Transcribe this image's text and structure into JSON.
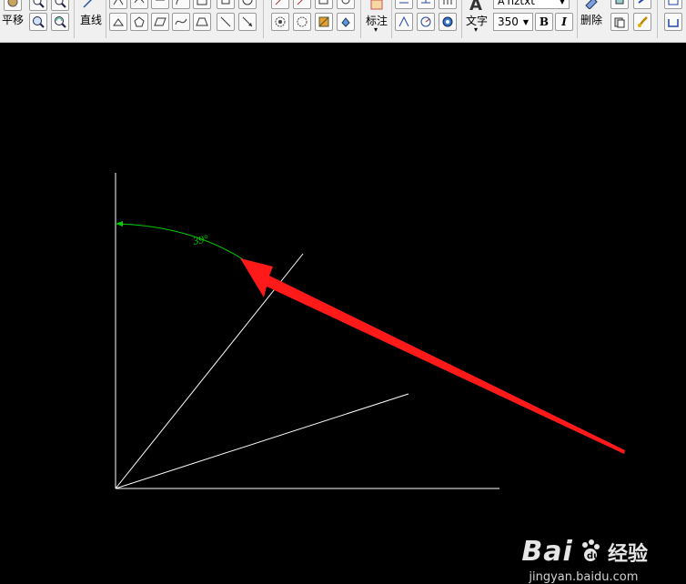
{
  "toolbar": {
    "pan_label": "平移",
    "line_label": "直线",
    "dimension_label": "标注",
    "text_label": "文字",
    "delete_label": "删除",
    "font_letter": "A",
    "font_name": "hztxt",
    "font_size": "350",
    "bold_label": "B",
    "italic_label": "I"
  },
  "drawing": {
    "angle_dimension": "39°",
    "colors": {
      "background": "#000000",
      "lines": "#ffffff",
      "dimension": "#00cc00",
      "arrow": "#ff1a1a"
    }
  },
  "watermark": {
    "logo": "Bai",
    "logo_tail": "经验",
    "site": "jingyan.baidu.com"
  }
}
